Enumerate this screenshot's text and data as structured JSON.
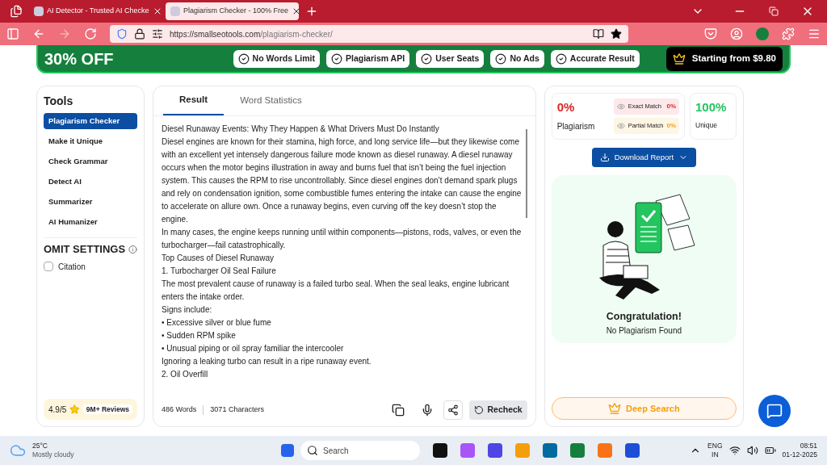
{
  "browser": {
    "tabs": [
      {
        "title": "AI Detector - Trusted AI Checke",
        "selected": false
      },
      {
        "title": "Plagiarism Checker - 100% Free",
        "selected": true
      }
    ],
    "url_host": "https://smallseotools.com",
    "url_path": "/plagiarism-checker/"
  },
  "banner": {
    "discount": "30% OFF",
    "features": [
      "No Words Limit",
      "Plagiarism API",
      "User Seats",
      "No Ads",
      "Accurate Result"
    ],
    "price": "Starting from $9.80"
  },
  "sidebar": {
    "title": "Tools",
    "items": [
      {
        "label": "Plagiarism Checker",
        "selected": true
      },
      {
        "label": "Make it Unique",
        "selected": false
      },
      {
        "label": "Check Grammar",
        "selected": false
      },
      {
        "label": "Detect AI",
        "selected": false
      },
      {
        "label": "Summarizer",
        "selected": false
      },
      {
        "label": "AI Humanizer",
        "selected": false
      }
    ],
    "omit_title": "OMIT SETTINGS",
    "options": [
      {
        "label": "Citation",
        "checked": false
      }
    ],
    "rating": "4.9/5",
    "reviews": "9M+ Reviews"
  },
  "editor": {
    "tabs": [
      {
        "label": "Result",
        "selected": true
      },
      {
        "label": "Word Statistics",
        "selected": false
      }
    ],
    "paragraphs": [
      "Diesel Runaway Events: Why They Happen & What Drivers Must Do Instantly",
      "Diesel engines are known for their stamina, high force, and long service life—but they likewise come with an excellent yet intensely dangerous failure mode known as diesel runaway. A diesel runaway occurs when the motor begins illustration in away and burns fuel that isn’t being the fuel injection system. This causes the RPM to rise uncontrollably. Since diesel engines don’t demand spark plugs and rely on condensation ignition, some combustible fumes entering the intake can cause the engine to accelerate on allure own. Once a runaway begins, even curving off the key doesn’t stop the engine.",
      "In many cases, the engine keeps running until within components—pistons, rods, valves, or even the turbocharger—fail catastrophically.",
      "Top Causes of Diesel Runaway",
      "1. Turbocharger Oil Seal Failure",
      "The most prevalent cause of runaway is a failed turbo seal. When the seal leaks, engine lubricant enters the intake order.",
      "Signs include:",
      "• Excessive silver or blue fume",
      "• Sudden RPM spike",
      "• Unusual piping or oil spray familiar the intercooler",
      "Ignoring a leaking turbo can result in a ripe runaway event.",
      "2. Oil Overfill"
    ],
    "words": "486 Words",
    "characters": "3071 Characters",
    "recheck": "Recheck"
  },
  "result": {
    "plagiarism_value": "0%",
    "plagiarism_label": "Plagiarism",
    "matches": [
      {
        "label": "Exact Match",
        "value": "0%",
        "kind": "exact"
      },
      {
        "label": "Partial Match",
        "value": "0%",
        "kind": "partial"
      }
    ],
    "unique_value": "100%",
    "unique_label": "Unique",
    "download": "Download Report",
    "congrats_title": "Congratulation!",
    "congrats_text": "No Plagiarism Found",
    "deep_search": "Deep Search"
  },
  "taskbar": {
    "temperature": "25°C",
    "weather": "Mostly cloudy",
    "search_placeholder": "Search",
    "lang": "ENG",
    "region": "IN",
    "time": "08:51",
    "date": "01-12-2025"
  }
}
